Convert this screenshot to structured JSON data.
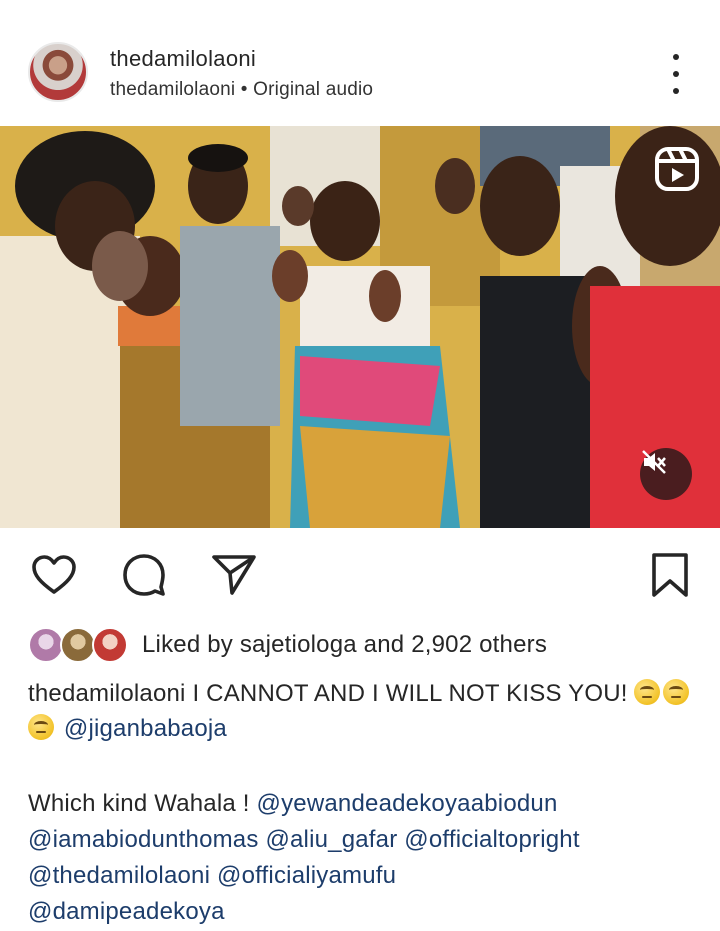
{
  "post": {
    "username": "thedamilolaoni",
    "audio_owner": "thedamilolaoni",
    "audio_separator": " • ",
    "audio_label": "Original audio"
  },
  "icons": {
    "more": "more-vertical-icon",
    "reels": "reels-icon",
    "mute": "speaker-muted-icon",
    "like": "heart-icon",
    "comment": "comment-icon",
    "share": "send-icon",
    "save": "bookmark-icon"
  },
  "likes": {
    "prefix": "Liked by ",
    "user": "sajetiologa",
    "middle": " and ",
    "others": "2,902 others"
  },
  "caption": {
    "user": "thedamilolaoni",
    "text": " I CANNOT AND I WILL NOT KISS YOU! ",
    "emoji_name": "face-with-rolling-eyes",
    "emoji_count": 3,
    "mention": "@jiganbabaoja"
  },
  "caption_line2": {
    "text": "Which kind Wahala ! ",
    "mentions": [
      "@yewandeadekoyaabiodun",
      "@iamabiodunthomas",
      "@aliu_gafar",
      "@officialtopright",
      "@thedamilolaoni",
      "@officialiyamufu",
      "@damipeadekoya"
    ]
  },
  "colors": {
    "text": "#262626",
    "mention": "#1d3d6b",
    "mute_bg": "#4a1d1f"
  }
}
